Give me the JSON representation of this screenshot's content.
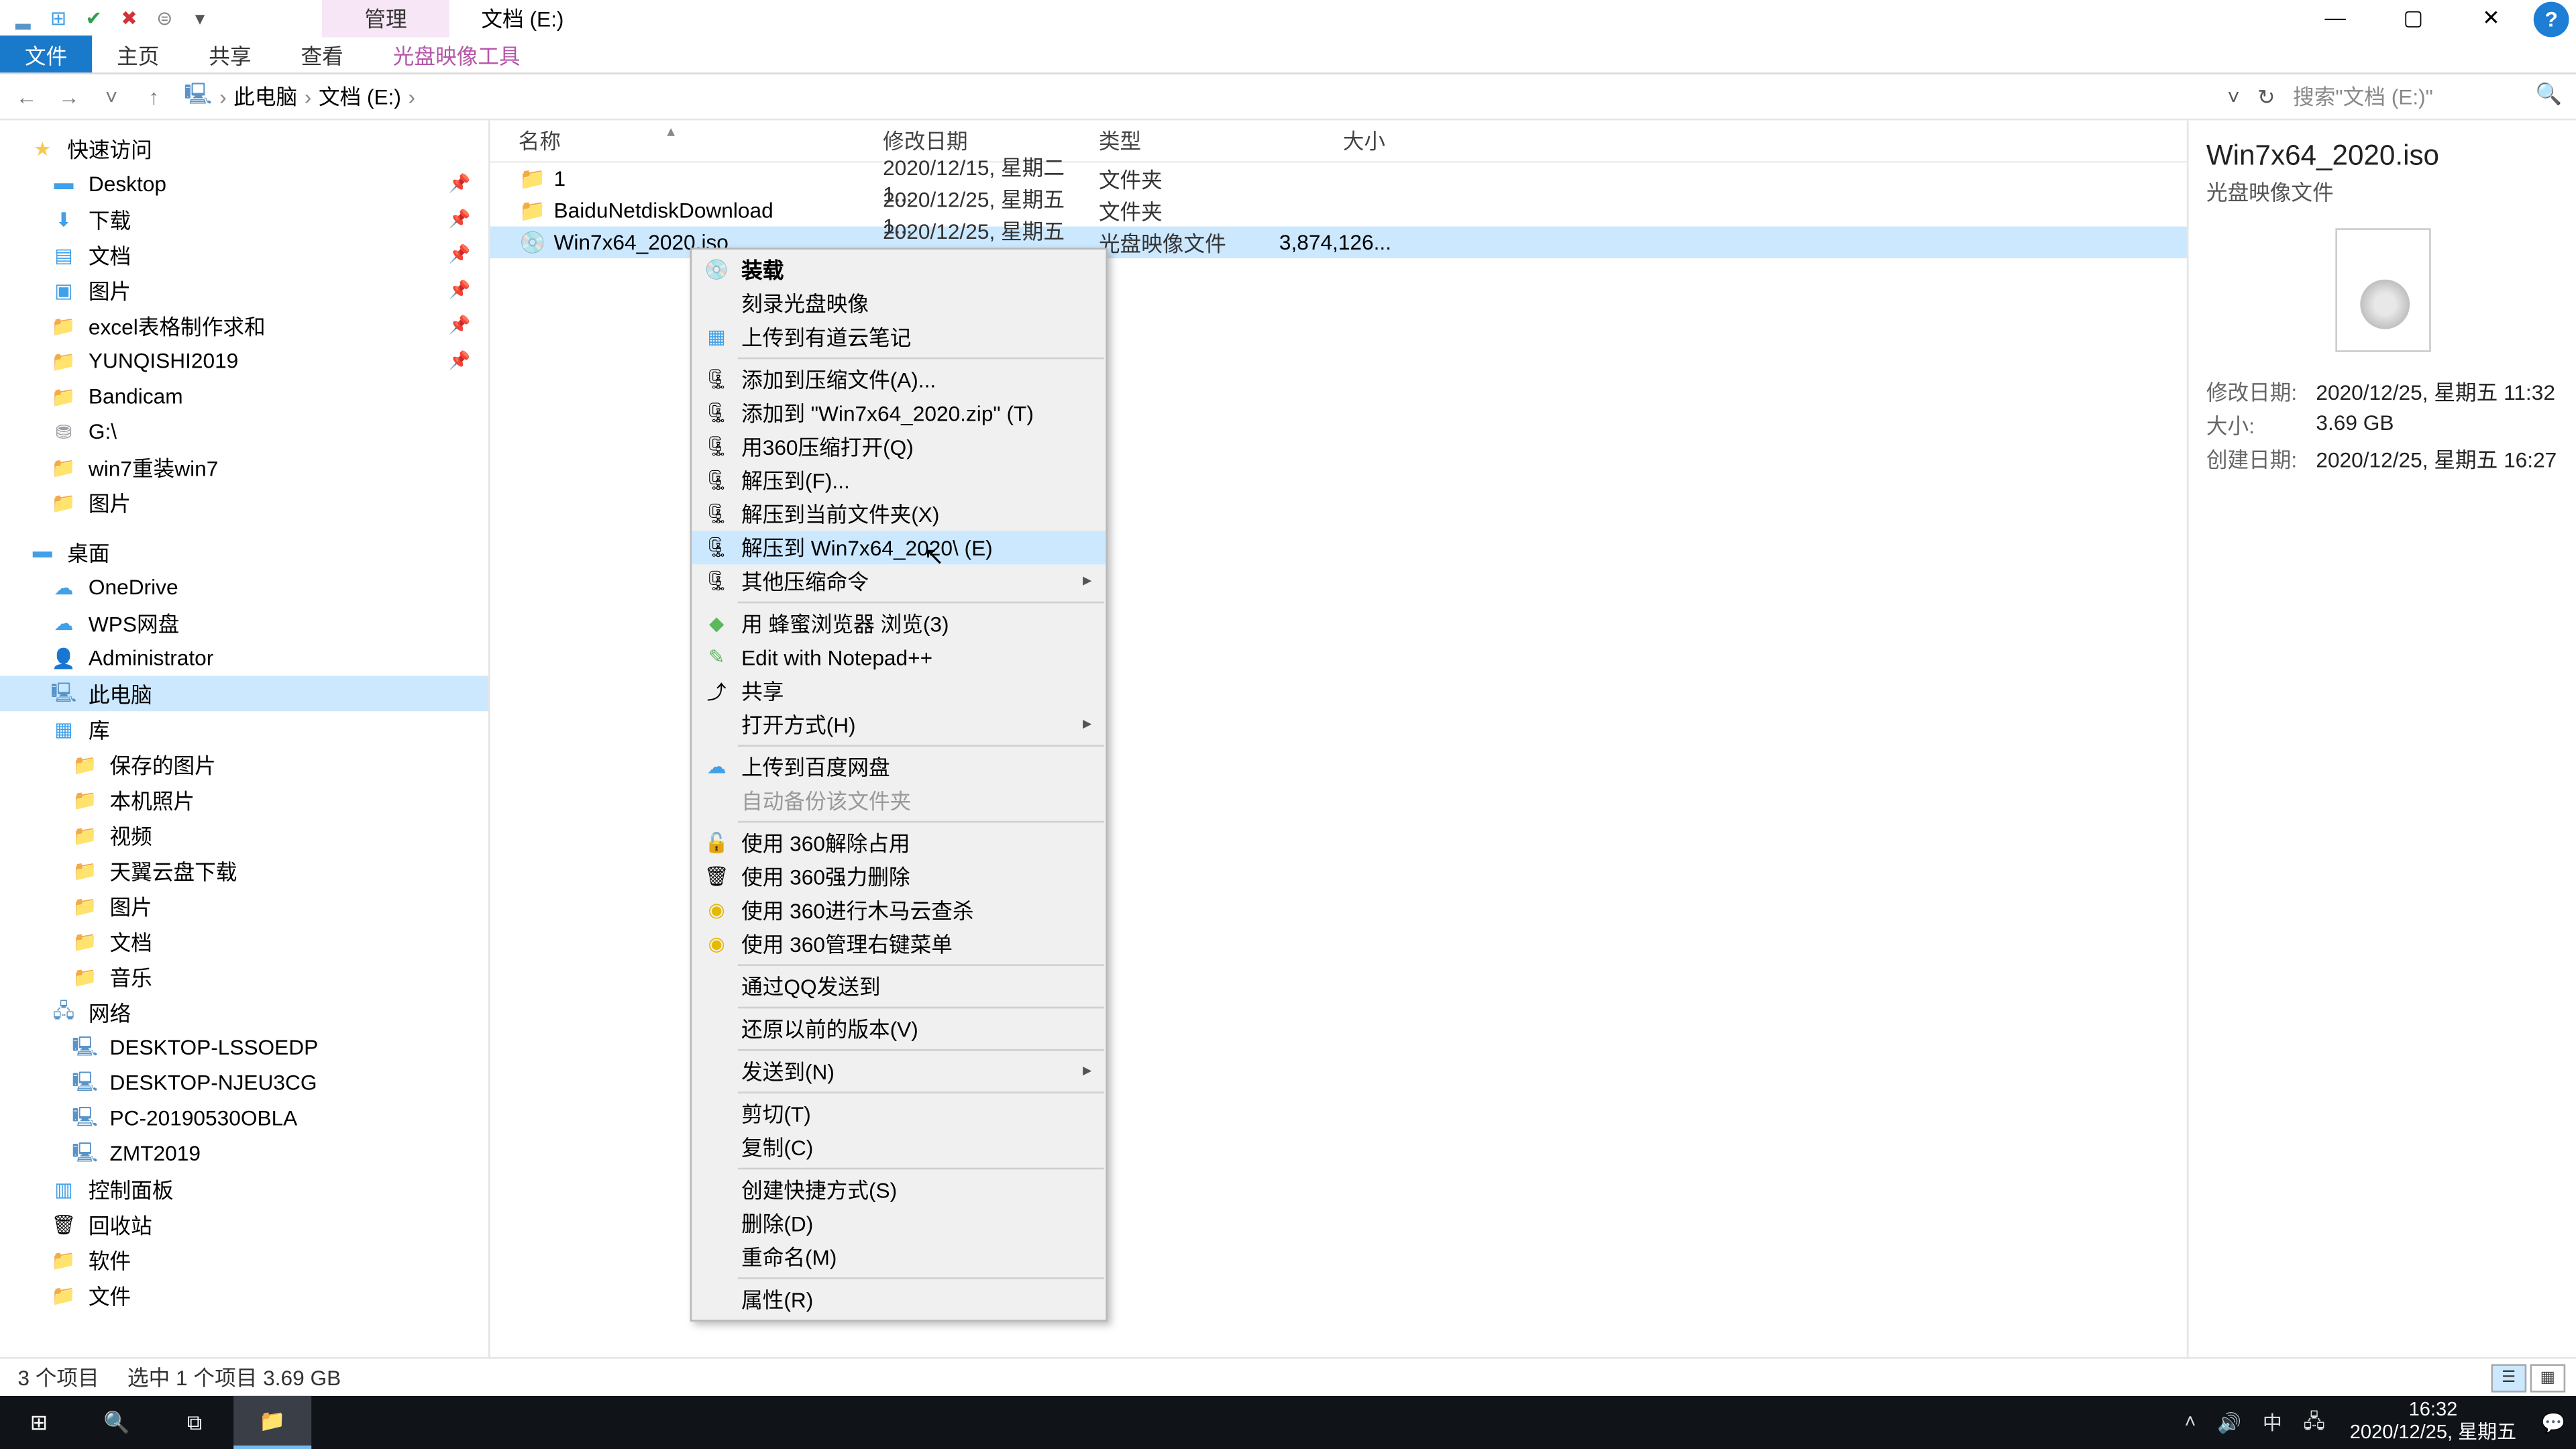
{
  "window": {
    "context_tab": "管理",
    "title": "文档 (E:)",
    "min": "—",
    "max": "▢",
    "close": "✕"
  },
  "qat": {
    "save": "⊞",
    "undo": "✔",
    "delete": "✖",
    "dropdown": "▾"
  },
  "ribbon": {
    "file": "文件",
    "home": "主页",
    "share": "共享",
    "view": "查看",
    "iso": "光盘映像工具"
  },
  "nav": {
    "back": "←",
    "fwd": "→",
    "up": "↑",
    "drop": "˅"
  },
  "breadcrumb": {
    "root": "此电脑",
    "drive": "文档 (E:)",
    "sep": "›"
  },
  "addrctrl": {
    "history": "˅",
    "refresh": "↻"
  },
  "search": {
    "placeholder": "搜索\"文档 (E:)\"",
    "icon": "🔍"
  },
  "tree": {
    "quick": "快速访问",
    "desktop": "Desktop",
    "downloads": "下载",
    "documents": "文档",
    "pictures": "图片",
    "excel": "excel表格制作求和",
    "yunqishi": "YUNQISHI2019",
    "bandicam": "Bandicam",
    "gdrive": "G:\\",
    "win7": "win7重装win7",
    "pictures2": "图片",
    "desktop2": "桌面",
    "onedrive": "OneDrive",
    "wps": "WPS网盘",
    "admin": "Administrator",
    "thispc": "此电脑",
    "lib": "库",
    "savedpic": "保存的图片",
    "localpic": "本机照片",
    "video": "视频",
    "tianyi": "天翼云盘下载",
    "pictures3": "图片",
    "documents2": "文档",
    "music": "音乐",
    "network": "网络",
    "pc1": "DESKTOP-LSSOEDP",
    "pc2": "DESKTOP-NJEU3CG",
    "pc3": "PC-20190530OBLA",
    "pc4": "ZMT2019",
    "cpanel": "控制面板",
    "recycle": "回收站",
    "software": "软件",
    "files": "文件"
  },
  "headers": {
    "name": "名称",
    "date": "修改日期",
    "type": "类型",
    "size": "大小"
  },
  "rows": [
    {
      "icon": "📁",
      "name": "1",
      "date": "2020/12/15, 星期二 1...",
      "type": "文件夹",
      "size": ""
    },
    {
      "icon": "📁",
      "name": "BaiduNetdiskDownload",
      "date": "2020/12/25, 星期五 1...",
      "type": "文件夹",
      "size": ""
    },
    {
      "icon": "💿",
      "name": "Win7x64_2020.iso",
      "date": "2020/12/25, 星期五 1...",
      "type": "光盘映像文件",
      "size": "3,874,126..."
    }
  ],
  "ctx": {
    "mount": "装载",
    "burn": "刻录光盘映像",
    "youdao": "上传到有道云笔记",
    "addarchive": "添加到压缩文件(A)...",
    "addzip": "添加到 \"Win7x64_2020.zip\" (T)",
    "open360": "用360压缩打开(Q)",
    "extractto": "解压到(F)...",
    "extracthere": "解压到当前文件夹(X)",
    "extractfolder": "解压到 Win7x64_2020\\ (E)",
    "othercompress": "其他压缩命令",
    "browser": "用 蜂蜜浏览器 浏览(3)",
    "npp": "Edit with Notepad++",
    "share": "共享",
    "openwith": "打开方式(H)",
    "baidu": "上传到百度网盘",
    "autosync": "自动备份该文件夹",
    "unlock360": "使用 360解除占用",
    "forcedel360": "使用 360强力删除",
    "trojan360": "使用 360进行木马云查杀",
    "mgr360": "使用 360管理右键菜单",
    "qq": "通过QQ发送到",
    "restore": "还原以前的版本(V)",
    "sendto": "发送到(N)",
    "cut": "剪切(T)",
    "copy": "复制(C)",
    "shortcut": "创建快捷方式(S)",
    "delete": "删除(D)",
    "rename": "重命名(M)",
    "props": "属性(R)"
  },
  "details": {
    "title": "Win7x64_2020.iso",
    "sub": "光盘映像文件",
    "mlabel": "修改日期:",
    "mval": "2020/12/25, 星期五 11:32",
    "slabel": "大小:",
    "sval": "3.69 GB",
    "clabel": "创建日期:",
    "cval": "2020/12/25, 星期五 16:27"
  },
  "status": {
    "count": "3 个项目",
    "sel": "选中 1 个项目  3.69 GB"
  },
  "tray": {
    "up": "˄",
    "vol": "🔊",
    "ime": "中",
    "net": "🖧",
    "time": "16:32",
    "date": "2020/12/25, 星期五",
    "notif": "💬"
  },
  "colors": {
    "selection": "#cce8ff",
    "accent": "#1979ca",
    "taskbar": "#101318"
  }
}
